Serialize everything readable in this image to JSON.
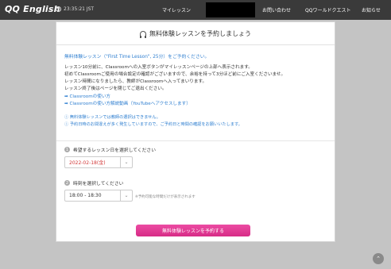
{
  "header": {
    "logo": "QQ English",
    "clock": "23:35:21 JST",
    "nav": {
      "my_lesson": "マイレッスン",
      "contact": "お問い合わせ",
      "quest": "QQワールドクエスト",
      "news": "お知らせ"
    }
  },
  "panel": {
    "title": "無料体験レッスンを予約しましょう",
    "lesson_title": "無料体験レッスン（\"First Time Lesson\", 25分）をご予約ください。",
    "description": [
      "レッスン10分前に、Classroomへの入室ボタンがマイレッスンページの上部へ表示されます。",
      "初めてClassroomご使用の場合設定の確認がございますので、余裕を持って3分ほど前にご入室くださいませ。",
      "レッスン時間になりましたら、教師がClassroomへ入ってまいります。",
      "レッスン終了後はページを閉じてご退出ください。"
    ],
    "links": {
      "how_to": "➡ Classroomの使い方",
      "video": "➡ Classroomの使い方解説動画（YouTubeへアクセスします）"
    },
    "notes": [
      "ⓘ 無料体験レッスンでは教師の選択はできません。",
      "ⓘ 予約日時のお間違えが多く発生していますので、ご予約日と時間の確認をお願いいたします。"
    ],
    "step1": {
      "num": "1",
      "label": "希望するレッスン日を選択してください",
      "value": "2022-02-18(金)"
    },
    "step2": {
      "num": "2",
      "label": "時刻を選択してください",
      "value": "18:00 - 18:30",
      "hint": "※予約可能な時間だけが表示されます"
    },
    "submit_label": "無料体験レッスンを予約する",
    "caret": "⌄"
  },
  "scroll_top": "⌃"
}
